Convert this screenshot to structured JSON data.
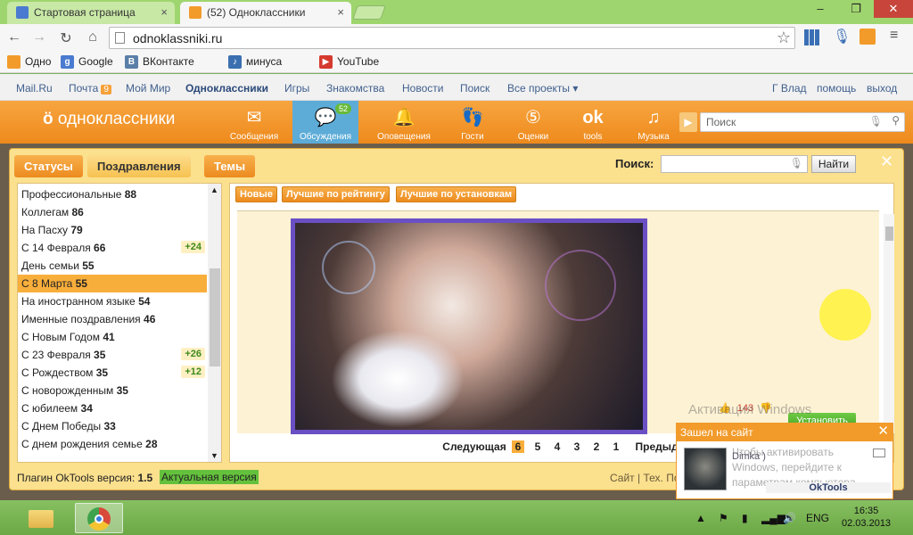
{
  "browser": {
    "tabs": [
      {
        "label": "Стартовая страница"
      },
      {
        "label": "(52) Одноклассники"
      }
    ],
    "url": "odnoklassniki.ru",
    "bookmarks": [
      "Одно",
      "Google",
      "ВКонтакте",
      "@",
      "минуса",
      "YouTube"
    ]
  },
  "mailbar": {
    "left": [
      "Mail.Ru",
      "Почта",
      "Мой Мир",
      "Одноклассники",
      "Игры",
      "Знакомства",
      "Новости",
      "Поиск",
      "Все проекты"
    ],
    "mail_count": "9",
    "right": [
      "Г Влад",
      "помощь",
      "выход"
    ]
  },
  "ok_header": {
    "logo": "одноклассники",
    "menu": [
      {
        "label": "Сообщения",
        "icon": "envelope-icon"
      },
      {
        "label": "Обсуждения",
        "icon": "chat-icon",
        "count": "52"
      },
      {
        "label": "Оповещения",
        "icon": "bell-icon"
      },
      {
        "label": "Гости",
        "icon": "footprints-icon"
      },
      {
        "label": "Оценки",
        "icon": "rating-5-icon"
      },
      {
        "label": "tools",
        "icon": "ok-icon"
      },
      {
        "label": "Музыка",
        "icon": "music-icon"
      }
    ],
    "search_placeholder": "Поиск"
  },
  "panel": {
    "tabs": [
      "Статусы",
      "Поздравления",
      "Темы"
    ],
    "active_tab": "Поздравления",
    "search_label": "Поиск:",
    "search_button": "Найти",
    "filters": [
      "Новые",
      "Лучшие по рейтингу",
      "Лучшие по установкам"
    ],
    "categories": [
      {
        "name": "Профессиональные",
        "count": "88",
        "plus": ""
      },
      {
        "name": "Коллегам",
        "count": "86",
        "plus": ""
      },
      {
        "name": "На Пасху",
        "count": "79",
        "plus": ""
      },
      {
        "name": "С 14 Февраля",
        "count": "66",
        "plus": "+24"
      },
      {
        "name": "День семьи",
        "count": "55",
        "plus": ""
      },
      {
        "name": "С 8 Марта",
        "count": "55",
        "plus": ""
      },
      {
        "name": "На иностранном языке",
        "count": "54",
        "plus": ""
      },
      {
        "name": "Именные поздравления",
        "count": "46",
        "plus": ""
      },
      {
        "name": "С Новым Годом",
        "count": "41",
        "plus": ""
      },
      {
        "name": "С 23 Февраля",
        "count": "35",
        "plus": "+26"
      },
      {
        "name": "С Рождеством",
        "count": "35",
        "plus": "+12"
      },
      {
        "name": "С новорожденным",
        "count": "35",
        "plus": ""
      },
      {
        "name": "С юбилеем",
        "count": "34",
        "plus": ""
      },
      {
        "name": "С Днем Победы",
        "count": "33",
        "plus": ""
      },
      {
        "name": "С днем рождения семье",
        "count": "28",
        "plus": ""
      }
    ],
    "selected_category": "С 8 Марта",
    "item": {
      "rating": "143",
      "install_button": "Установить"
    },
    "pager": {
      "next": "Следующая",
      "pages": [
        "6",
        "5",
        "4",
        "3",
        "2",
        "1"
      ],
      "current": "6",
      "prev": "Предыду"
    },
    "footer": {
      "plugin_label": "Плагин OkTools версия: ",
      "version": "1.5",
      "status": "Актуальная версия",
      "links": "Сайт | Тех. По"
    }
  },
  "toast": {
    "title": "Зашел на сайт",
    "name": "Dimka )",
    "brand": "OkTools"
  },
  "windows_watermark": {
    "line1": "Активация Windows",
    "line2": "Чтобы активировать Windows, перейдите к параметрам компьютера."
  },
  "taskbar": {
    "lang": "ENG",
    "time": "16:35",
    "date": "02.03.2013"
  },
  "colors": {
    "ok_orange": "#ee8a1c",
    "panel_bg": "#fbe08e",
    "accent_green": "#64c13c",
    "selected": "#f8ae3b"
  }
}
